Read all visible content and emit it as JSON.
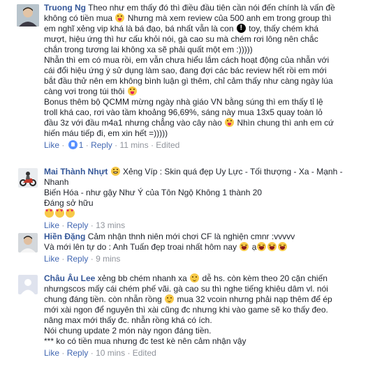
{
  "comments": [
    {
      "author": "Truong Ng",
      "lines": [
        "Theo như em thấy đó thì điều đầu tiên cần nói đến chính là vấn đề",
        "không có tiền mua",
        "Nhưng mà xem review của 500 anh em trong group thì",
        "em nghĩ xẻng vip khá là bá đạo, bá nhất vẫn là con",
        "toy, thấy chém khá",
        "mượt, hiệu ứng thì hư cấu khỏi nói, gà cao su mà chém rơi lông nên chắc",
        "chắn trong tương lai không xa sẽ phải quất một em :)))))",
        "Nhẫn thì em có mua rồi, em vẫn chưa hiểu lắm cách hoạt động của nhẫn với",
        "cái đổi hiệu ứng ý sử dụng làm sao, đang đợi các bác review hết rồi em mới",
        "bắt đầu thử nên em không bình luận gì thêm, chỉ cảm thấy như càng ngày lúa",
        "càng vơi trong túi thôi",
        "Bonus thêm bộ QCMM mừng ngày nhà giáo VN bằng súng thì em thấy tỉ lệ",
        "troll khá cao, rơi vào tầm khoảng 96,69%, sáng này mua 13x5 quay toàn lỏ",
        "đầu 3z với đầu m4a1 nhưng chẳng vào cây nào",
        "Nhìn chung thì anh em cứ",
        "hiến máu tiếp đi, em xin hết =)))))"
      ],
      "actions": {
        "like": "Like",
        "reply": "Reply",
        "likes": "1",
        "time": "11 mins",
        "edited": "Edited"
      }
    },
    {
      "author": "Mai Thành Nhựt",
      "lines": [
        "Xẻng Víp : Skin quá đẹp Uy Lực - Tối thượng - Xa - Mạnh -",
        "Nhanh",
        "Biến Hóa - như gậy Như Ý của Tôn Ngộ Không 1 thành 20",
        "Đáng sở hữu"
      ],
      "actions": {
        "like": "Like",
        "reply": "Reply",
        "time": "13 mins"
      }
    },
    {
      "author": "Hiền Đặng",
      "lines": [
        "Cảm nhận thnh niên mới chơi CF là nghiện cmnr :vvvvv",
        "Và mới lên tự do : Anh Tuấn đẹp troai nhất hôm nay",
        "ạ"
      ],
      "actions": {
        "like": "Like",
        "reply": "Reply",
        "time": "9 mins"
      }
    },
    {
      "author": "Châu Âu Lee",
      "lines": [
        "xẻng bb chém nhanh xa",
        "dễ hs. còn kèm theo 20 cặn chiến",
        "nhưngscos mấy cái chém phế vãi. gà cao su thì nghe tiếng khiêu dâm vl. nói",
        "chung đáng tiền. còn nhẫn rồng",
        "mua 32 vcoin nhưng phải nạp thêm để ép",
        "mới xài ngon để nguyên thì xài cũng đc nhưng khi vào game sẽ ko thấy đeo.",
        "nâng max mới thấy đc. nhẫn rồng khá có ích.",
        "Nói chung update 2 món này ngon đáng tiền.",
        "*** ko có tiền mua nhưng đc test kè nên cảm nhận vậy"
      ],
      "actions": {
        "like": "Like",
        "reply": "Reply",
        "time": "10 mins",
        "edited": "Edited"
      }
    }
  ]
}
